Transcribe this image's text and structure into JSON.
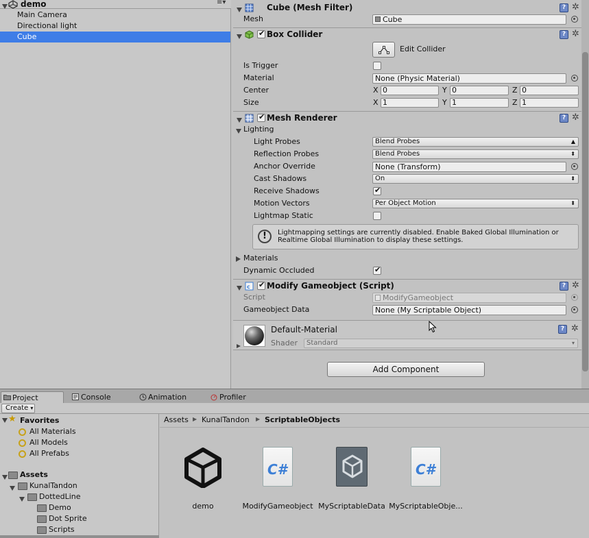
{
  "hierarchy": {
    "scene_name": "demo",
    "menu_glyph": "≡▾",
    "items": [
      {
        "label": "Main Camera"
      },
      {
        "label": "Directional light"
      },
      {
        "label": "Cube",
        "selected": true
      }
    ]
  },
  "inspector": {
    "mesh_filter": {
      "title": "Cube (Mesh Filter)",
      "mesh_label": "Mesh",
      "mesh_value": "Cube"
    },
    "box_collider": {
      "title": "Box Collider",
      "edit_label": "Edit Collider",
      "is_trigger_label": "Is Trigger",
      "material_label": "Material",
      "material_value": "None (Physic Material)",
      "center_label": "Center",
      "center": {
        "x": "0",
        "y": "0",
        "z": "0"
      },
      "size_label": "Size",
      "size": {
        "x": "1",
        "y": "1",
        "z": "1"
      },
      "axis_x": "X",
      "axis_y": "Y",
      "axis_z": "Z"
    },
    "mesh_renderer": {
      "title": "Mesh Renderer",
      "lighting_label": "Lighting",
      "light_probes_label": "Light Probes",
      "light_probes_value": "Blend Probes",
      "reflection_probes_label": "Reflection Probes",
      "reflection_probes_value": "Blend Probes",
      "anchor_override_label": "Anchor Override",
      "anchor_override_value": "None (Transform)",
      "cast_shadows_label": "Cast Shadows",
      "cast_shadows_value": "On",
      "receive_shadows_label": "Receive Shadows",
      "motion_vectors_label": "Motion Vectors",
      "motion_vectors_value": "Per Object Motion",
      "lightmap_static_label": "Lightmap Static",
      "info_text": "Lightmapping settings are currently disabled. Enable Baked Global Illumination or Realtime Global Illumination to display these settings.",
      "materials_label": "Materials",
      "dynamic_occluded_label": "Dynamic Occluded"
    },
    "script_comp": {
      "title": "Modify Gameobject (Script)",
      "script_label": "Script",
      "script_value": "ModifyGameobject",
      "data_label": "Gameobject Data",
      "data_value": "None (My Scriptable Object)"
    },
    "material": {
      "name": "Default-Material",
      "shader_label": "Shader",
      "shader_value": "Standard"
    },
    "add_component_label": "Add Component"
  },
  "bottom_tabs": [
    {
      "label": "Project"
    },
    {
      "label": "Console"
    },
    {
      "label": "Animation"
    },
    {
      "label": "Profiler"
    }
  ],
  "project": {
    "create_label": "Create",
    "favorites_label": "Favorites",
    "favorites": [
      "All Materials",
      "All Models",
      "All Prefabs"
    ],
    "assets_label": "Assets",
    "tree": [
      "KunalTandon",
      "DottedLine",
      "Demo",
      "Dot Sprite",
      "Scripts"
    ],
    "breadcrumb": [
      "Assets",
      "KunalTandon",
      "ScriptableObjects"
    ],
    "items": [
      "demo",
      "ModifyGameobject",
      "MyScriptableData",
      "MyScriptableObje..."
    ]
  },
  "colors": {
    "selection": "#3e7de7",
    "panel": "#c2c2c2"
  }
}
